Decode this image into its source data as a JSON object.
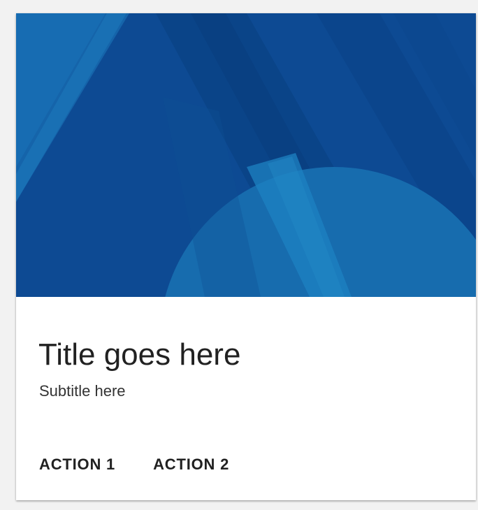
{
  "card": {
    "title": "Title goes here",
    "subtitle": "Subtitle here",
    "actions": [
      {
        "label": "ACTION 1"
      },
      {
        "label": "ACTION 2"
      }
    ]
  },
  "colors": {
    "media_base": "#0d4a93",
    "media_accent": "#1b78b8",
    "text_primary": "#212121"
  }
}
